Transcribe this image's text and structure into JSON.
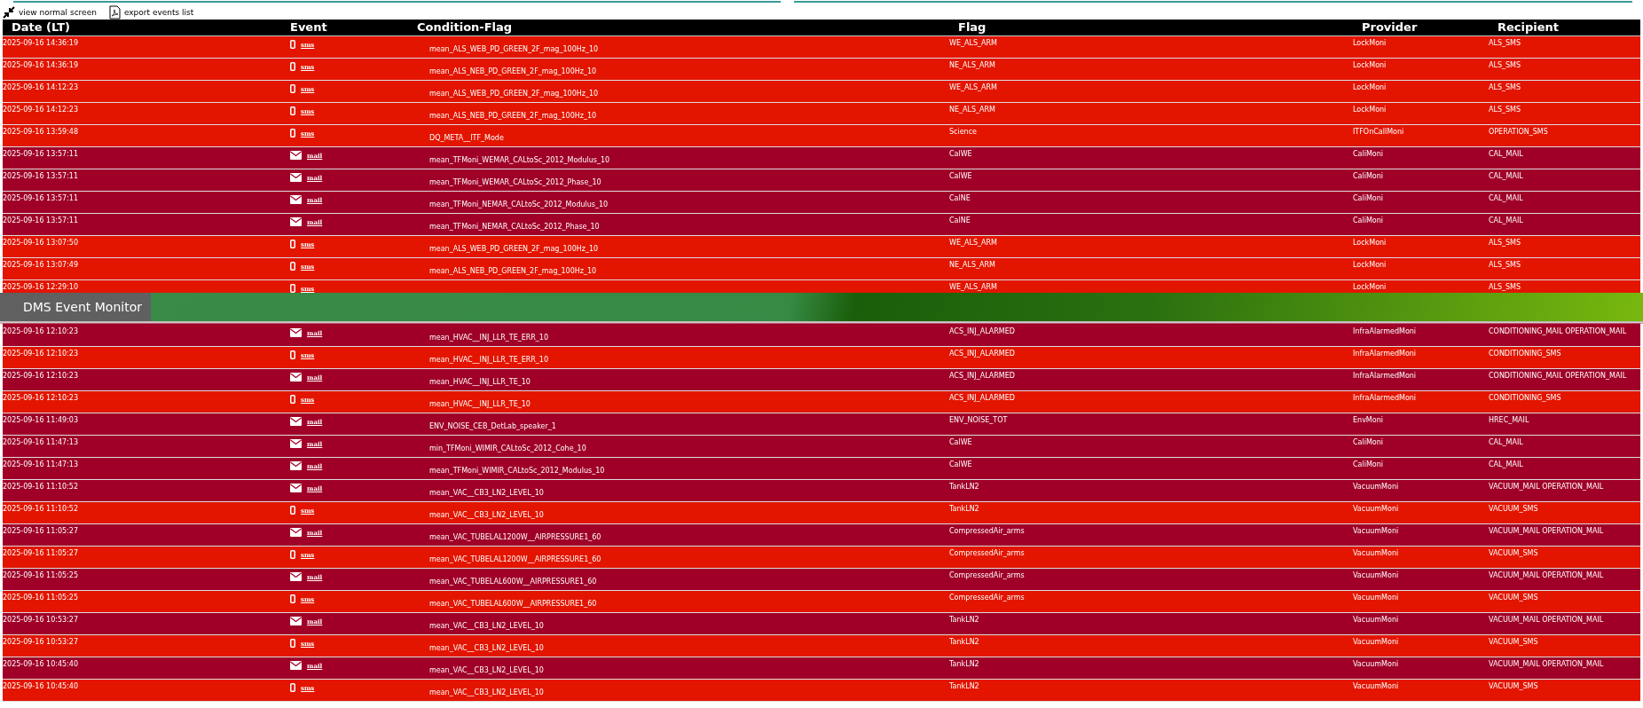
{
  "toolbar": [
    {
      "kind": "shrink",
      "label": "view normal screen"
    },
    {
      "kind": "pdf",
      "label": "export events list"
    }
  ],
  "table": {
    "columns": [
      "Date (LT)",
      "Event",
      "Condition-Flag",
      "Flag",
      "Provider",
      "Recipient"
    ],
    "rows": [
      {
        "date": "2025-09-16 14:36:19",
        "event": {
          "kind": "sms",
          "label": "sms"
        },
        "condition": "mean_ALS_WEB_PD_GREEN_2F_mag_100Hz_10",
        "flag": "WE_ALS_ARM",
        "provider": "LockMoni",
        "recipient": "ALS_SMS"
      },
      {
        "date": "2025-09-16 14:36:19",
        "event": {
          "kind": "sms",
          "label": "sms"
        },
        "condition": "mean_ALS_NEB_PD_GREEN_2F_mag_100Hz_10",
        "flag": "NE_ALS_ARM",
        "provider": "LockMoni",
        "recipient": "ALS_SMS"
      },
      {
        "date": "2025-09-16 14:12:23",
        "event": {
          "kind": "sms",
          "label": "sms"
        },
        "condition": "mean_ALS_WEB_PD_GREEN_2F_mag_100Hz_10",
        "flag": "WE_ALS_ARM",
        "provider": "LockMoni",
        "recipient": "ALS_SMS"
      },
      {
        "date": "2025-09-16 14:12:23",
        "event": {
          "kind": "sms",
          "label": "sms"
        },
        "condition": "mean_ALS_NEB_PD_GREEN_2F_mag_100Hz_10",
        "flag": "NE_ALS_ARM",
        "provider": "LockMoni",
        "recipient": "ALS_SMS"
      },
      {
        "date": "2025-09-16 13:59:48",
        "event": {
          "kind": "sms",
          "label": "sms"
        },
        "condition": "DQ_META__ITF_Mode",
        "flag": "Science",
        "provider": "ITFOnCallMoni",
        "recipient": "OPERATION_SMS"
      },
      {
        "date": "2025-09-16 13:57:11",
        "event": {
          "kind": "mail",
          "label": "mail"
        },
        "condition": "mean_TFMoni_WEMAR_CALtoSc_2012_Modulus_10",
        "flag": "CalWE",
        "provider": "CaliMoni",
        "recipient": "CAL_MAIL"
      },
      {
        "date": "2025-09-16 13:57:11",
        "event": {
          "kind": "mail",
          "label": "mail"
        },
        "condition": "mean_TFMoni_WEMAR_CALtoSc_2012_Phase_10",
        "flag": "CalWE",
        "provider": "CaliMoni",
        "recipient": "CAL_MAIL"
      },
      {
        "date": "2025-09-16 13:57:11",
        "event": {
          "kind": "mail",
          "label": "mail"
        },
        "condition": "mean_TFMoni_NEMAR_CALtoSc_2012_Modulus_10",
        "flag": "CalNE",
        "provider": "CaliMoni",
        "recipient": "CAL_MAIL"
      },
      {
        "date": "2025-09-16 13:57:11",
        "event": {
          "kind": "mail",
          "label": "mail"
        },
        "condition": "mean_TFMoni_NEMAR_CALtoSc_2012_Phase_10",
        "flag": "CalNE",
        "provider": "CaliMoni",
        "recipient": "CAL_MAIL"
      },
      {
        "date": "2025-09-16 13:07:50",
        "event": {
          "kind": "sms",
          "label": "sms"
        },
        "condition": "mean_ALS_WEB_PD_GREEN_2F_mag_100Hz_10",
        "flag": "WE_ALS_ARM",
        "provider": "LockMoni",
        "recipient": "ALS_SMS"
      },
      {
        "date": "2025-09-16 13:07:49",
        "event": {
          "kind": "sms",
          "label": "sms"
        },
        "condition": "mean_ALS_NEB_PD_GREEN_2F_mag_100Hz_10",
        "flag": "NE_ALS_ARM",
        "provider": "LockMoni",
        "recipient": "ALS_SMS"
      },
      {
        "date": "2025-09-16 12:29:10",
        "event": {
          "kind": "sms",
          "label": "sms"
        },
        "flag": "WE_ALS_ARM",
        "provider": "LockMoni",
        "recipient": "ALS_SMS"
      },
      {
        "date": "2025-09-16 12:10:23",
        "event": {
          "kind": "mail",
          "label": "mail"
        },
        "condition": "mean_HVAC__INJ_LLR_TE_ERR_10",
        "flag": "ACS_INJ_ALARMED",
        "provider": "InfraAlarmedMoni",
        "recipient": "CONDITIONING_MAIL OPERATION_MAIL"
      },
      {
        "date": "2025-09-16 12:10:23",
        "event": {
          "kind": "sms",
          "label": "sms"
        },
        "condition": "mean_HVAC__INJ_LLR_TE_ERR_10",
        "flag": "ACS_INJ_ALARMED",
        "provider": "InfraAlarmedMoni",
        "recipient": "CONDITIONING_SMS"
      },
      {
        "date": "2025-09-16 12:10:23",
        "event": {
          "kind": "mail",
          "label": "mail"
        },
        "condition": "mean_HVAC__INJ_LLR_TE_10",
        "flag": "ACS_INJ_ALARMED",
        "provider": "InfraAlarmedMoni",
        "recipient": "CONDITIONING_MAIL OPERATION_MAIL"
      },
      {
        "date": "2025-09-16 12:10:23",
        "event": {
          "kind": "sms",
          "label": "sms"
        },
        "condition": "mean_HVAC__INJ_LLR_TE_10",
        "flag": "ACS_INJ_ALARMED",
        "provider": "InfraAlarmedMoni",
        "recipient": "CONDITIONING_SMS"
      },
      {
        "date": "2025-09-16 11:49:03",
        "event": {
          "kind": "mail",
          "label": "mail"
        },
        "condition": "ENV_NOISE_CEB_DetLab_speaker_1",
        "flag": "ENV_NOISE_TOT",
        "provider": "EnvMoni",
        "recipient": "HREC_MAIL"
      },
      {
        "date": "2025-09-16 11:47:13",
        "event": {
          "kind": "mail",
          "label": "mail"
        },
        "condition": "min_TFMoni_WIMIR_CALtoSc_2012_Cohe_10",
        "flag": "CalWE",
        "provider": "CaliMoni",
        "recipient": "CAL_MAIL"
      },
      {
        "date": "2025-09-16 11:47:13",
        "event": {
          "kind": "mail",
          "label": "mail"
        },
        "condition": "mean_TFMoni_WIMIR_CALtoSc_2012_Modulus_10",
        "flag": "CalWE",
        "provider": "CaliMoni",
        "recipient": "CAL_MAIL"
      },
      {
        "date": "2025-09-16 11:10:52",
        "event": {
          "kind": "mail",
          "label": "mail"
        },
        "condition": "mean_VAC__CB3_LN2_LEVEL_10",
        "flag": "TankLN2",
        "provider": "VacuumMoni",
        "recipient": "VACUUM_MAIL OPERATION_MAIL"
      },
      {
        "date": "2025-09-16 11:10:52",
        "event": {
          "kind": "sms",
          "label": "sms"
        },
        "condition": "mean_VAC__CB3_LN2_LEVEL_10",
        "flag": "TankLN2",
        "provider": "VacuumMoni",
        "recipient": "VACUUM_SMS"
      },
      {
        "date": "2025-09-16 11:05:27",
        "event": {
          "kind": "mail",
          "label": "mail"
        },
        "condition": "mean_VAC_TUBELAL1200W__AIRPRESSURE1_60",
        "flag": "CompressedAir_arms",
        "provider": "VacuumMoni",
        "recipient": "VACUUM_MAIL OPERATION_MAIL"
      },
      {
        "date": "2025-09-16 11:05:27",
        "event": {
          "kind": "sms",
          "label": "sms"
        },
        "condition": "mean_VAC_TUBELAL1200W__AIRPRESSURE1_60",
        "flag": "CompressedAir_arms",
        "provider": "VacuumMoni",
        "recipient": "VACUUM_SMS"
      },
      {
        "date": "2025-09-16 11:05:25",
        "event": {
          "kind": "mail",
          "label": "mail"
        },
        "condition": "mean_VAC_TUBELAL600W__AIRPRESSURE1_60",
        "flag": "CompressedAir_arms",
        "provider": "VacuumMoni",
        "recipient": "VACUUM_MAIL OPERATION_MAIL"
      },
      {
        "date": "2025-09-16 11:05:25",
        "event": {
          "kind": "sms",
          "label": "sms"
        },
        "condition": "mean_VAC_TUBELAL600W__AIRPRESSURE1_60",
        "flag": "CompressedAir_arms",
        "provider": "VacuumMoni",
        "recipient": "VACUUM_SMS"
      },
      {
        "date": "2025-09-16 10:53:27",
        "event": {
          "kind": "mail",
          "label": "mail"
        },
        "condition": "mean_VAC__CB3_LN2_LEVEL_10",
        "flag": "TankLN2",
        "provider": "VacuumMoni",
        "recipient": "VACUUM_MAIL OPERATION_MAIL"
      },
      {
        "date": "2025-09-16 10:53:27",
        "event": {
          "kind": "sms",
          "label": "sms"
        },
        "condition": "mean_VAC__CB3_LN2_LEVEL_10",
        "flag": "TankLN2",
        "provider": "VacuumMoni",
        "recipient": "VACUUM_SMS"
      },
      {
        "date": "2025-09-16 10:45:40",
        "event": {
          "kind": "mail",
          "label": "mail"
        },
        "condition": "mean_VAC__CB3_LN2_LEVEL_10",
        "flag": "TankLN2",
        "provider": "VacuumMoni",
        "recipient": "VACUUM_MAIL OPERATION_MAIL"
      },
      {
        "date": "2025-09-16 10:45:40",
        "event": {
          "kind": "sms",
          "label": "sms"
        },
        "condition": "mean_VAC__CB3_LN2_LEVEL_10",
        "flag": "TankLN2",
        "provider": "VacuumMoni",
        "recipient": "VACUUM_SMS"
      }
    ]
  },
  "banner": {
    "title": "DMS Event Monitor"
  }
}
